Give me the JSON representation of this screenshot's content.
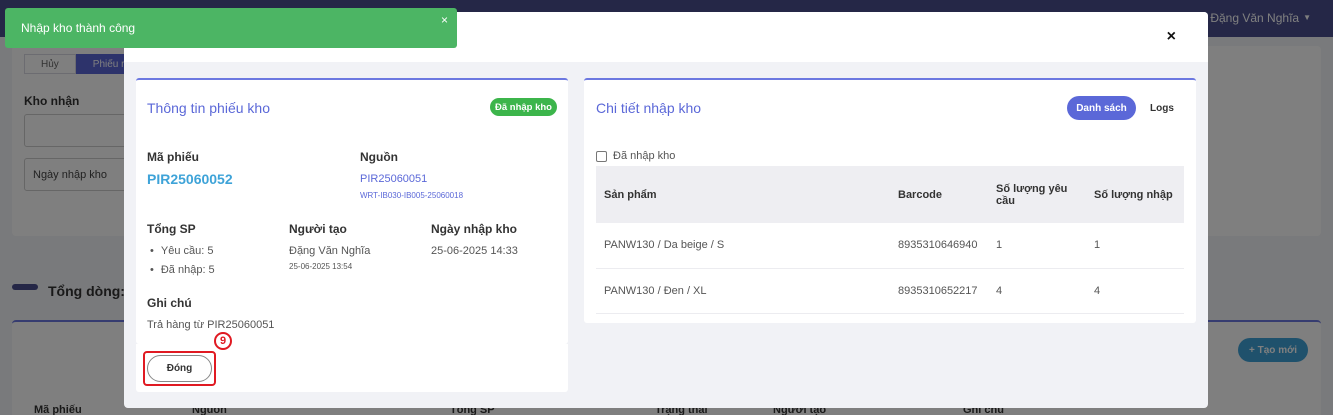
{
  "background": {
    "user_greeting": "Hi, Đặng Văn Nghĩa",
    "tabs": [
      "Hủy",
      "Phiếu r"
    ],
    "warehouse_label": "Kho nhận",
    "date_placeholder": "Ngày nhập kho",
    "total_label": "Tổng dòng:",
    "create_button": "+ Tạo mới",
    "table_headers": [
      "Mã phiếu",
      "Nguồn",
      "Tổng SP",
      "Trạng thái",
      "Người tạo",
      "Ghi chú"
    ]
  },
  "toast": {
    "message": "Nhập kho thành công",
    "close_glyph": "×"
  },
  "modal": {
    "close_glyph": "×",
    "info_panel": {
      "title": "Thông tin phiếu kho",
      "status_badge": "Đã nhập kho",
      "code_label": "Mã phiếu",
      "code_value": "PIR25060052",
      "source_label": "Nguồn",
      "source_value": "PIR25060051",
      "source_sub": "WRT-IB030-IB005-25060018",
      "total_label": "Tổng SP",
      "total_requested": "Yêu cầu: 5",
      "total_imported": "Đã nhập: 5",
      "creator_label": "Người tạo",
      "creator_name": "Đặng Văn Nghĩa",
      "creator_time": "25-06-2025 13:54",
      "import_date_label": "Ngày nhập kho",
      "import_date_value": "25-06-2025 14:33",
      "note_label": "Ghi chú",
      "note_value": "Trả hàng từ PIR25060051",
      "close_button": "Đóng",
      "step_number": "9"
    },
    "detail_panel": {
      "title": "Chi tiết nhập kho",
      "list_button": "Danh sách",
      "logs_button": "Logs",
      "checkbox_label": "Đã nhập kho",
      "columns": [
        "Sản phẩm",
        "Barcode",
        "Số lượng yêu cầu",
        "Số lượng nhập"
      ],
      "rows": [
        [
          "PANW130 / Da beige / S",
          "8935310646940",
          "1",
          "1"
        ],
        [
          "PANW130 / Đen / XL",
          "8935310652217",
          "4",
          "4"
        ]
      ]
    }
  }
}
